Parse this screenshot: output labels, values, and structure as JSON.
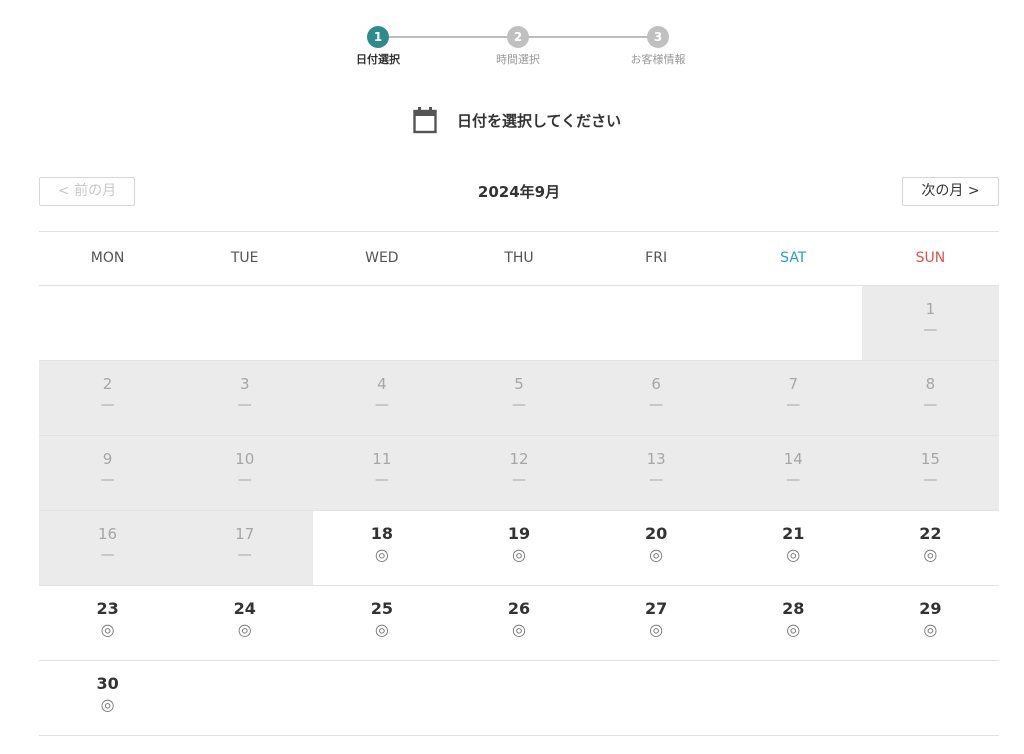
{
  "stepper": {
    "steps": [
      {
        "number": "1",
        "label": "日付選択",
        "active": true
      },
      {
        "number": "2",
        "label": "時間選択",
        "active": false
      },
      {
        "number": "3",
        "label": "お客様情報",
        "active": false
      }
    ]
  },
  "heading": {
    "icon": "calendar-icon",
    "text": "日付を選択してください"
  },
  "month_nav": {
    "prev_label": "< 前の月",
    "next_label": "次の月 >",
    "title": "2024年9月"
  },
  "colors": {
    "accent": "#2e8b8b",
    "saturday": "#2a98c9",
    "sunday": "#e05252",
    "disabled_bg": "#ebebeb"
  },
  "calendar": {
    "weekdays": [
      "MON",
      "TUE",
      "WED",
      "THU",
      "FRI",
      "SAT",
      "SUN"
    ],
    "weeks": [
      [
        {
          "day": "",
          "mark": "",
          "status": "empty"
        },
        {
          "day": "",
          "mark": "",
          "status": "empty"
        },
        {
          "day": "",
          "mark": "",
          "status": "empty"
        },
        {
          "day": "",
          "mark": "",
          "status": "empty"
        },
        {
          "day": "",
          "mark": "",
          "status": "empty"
        },
        {
          "day": "",
          "mark": "",
          "status": "empty"
        },
        {
          "day": "1",
          "mark": "—",
          "status": "disabled"
        }
      ],
      [
        {
          "day": "2",
          "mark": "—",
          "status": "disabled"
        },
        {
          "day": "3",
          "mark": "—",
          "status": "disabled"
        },
        {
          "day": "4",
          "mark": "—",
          "status": "disabled"
        },
        {
          "day": "5",
          "mark": "—",
          "status": "disabled"
        },
        {
          "day": "6",
          "mark": "—",
          "status": "disabled"
        },
        {
          "day": "7",
          "mark": "—",
          "status": "disabled"
        },
        {
          "day": "8",
          "mark": "—",
          "status": "disabled"
        }
      ],
      [
        {
          "day": "9",
          "mark": "—",
          "status": "disabled"
        },
        {
          "day": "10",
          "mark": "—",
          "status": "disabled"
        },
        {
          "day": "11",
          "mark": "—",
          "status": "disabled"
        },
        {
          "day": "12",
          "mark": "—",
          "status": "disabled"
        },
        {
          "day": "13",
          "mark": "—",
          "status": "disabled"
        },
        {
          "day": "14",
          "mark": "—",
          "status": "disabled"
        },
        {
          "day": "15",
          "mark": "—",
          "status": "disabled"
        }
      ],
      [
        {
          "day": "16",
          "mark": "—",
          "status": "disabled"
        },
        {
          "day": "17",
          "mark": "—",
          "status": "disabled"
        },
        {
          "day": "18",
          "mark": "◎",
          "status": "available"
        },
        {
          "day": "19",
          "mark": "◎",
          "status": "available"
        },
        {
          "day": "20",
          "mark": "◎",
          "status": "available"
        },
        {
          "day": "21",
          "mark": "◎",
          "status": "available"
        },
        {
          "day": "22",
          "mark": "◎",
          "status": "available"
        }
      ],
      [
        {
          "day": "23",
          "mark": "◎",
          "status": "available"
        },
        {
          "day": "24",
          "mark": "◎",
          "status": "available"
        },
        {
          "day": "25",
          "mark": "◎",
          "status": "available"
        },
        {
          "day": "26",
          "mark": "◎",
          "status": "available"
        },
        {
          "day": "27",
          "mark": "◎",
          "status": "available"
        },
        {
          "day": "28",
          "mark": "◎",
          "status": "available"
        },
        {
          "day": "29",
          "mark": "◎",
          "status": "available"
        }
      ],
      [
        {
          "day": "30",
          "mark": "◎",
          "status": "available"
        },
        {
          "day": "",
          "mark": "",
          "status": "empty"
        },
        {
          "day": "",
          "mark": "",
          "status": "empty"
        },
        {
          "day": "",
          "mark": "",
          "status": "empty"
        },
        {
          "day": "",
          "mark": "",
          "status": "empty"
        },
        {
          "day": "",
          "mark": "",
          "status": "empty"
        },
        {
          "day": "",
          "mark": "",
          "status": "empty"
        }
      ]
    ]
  }
}
